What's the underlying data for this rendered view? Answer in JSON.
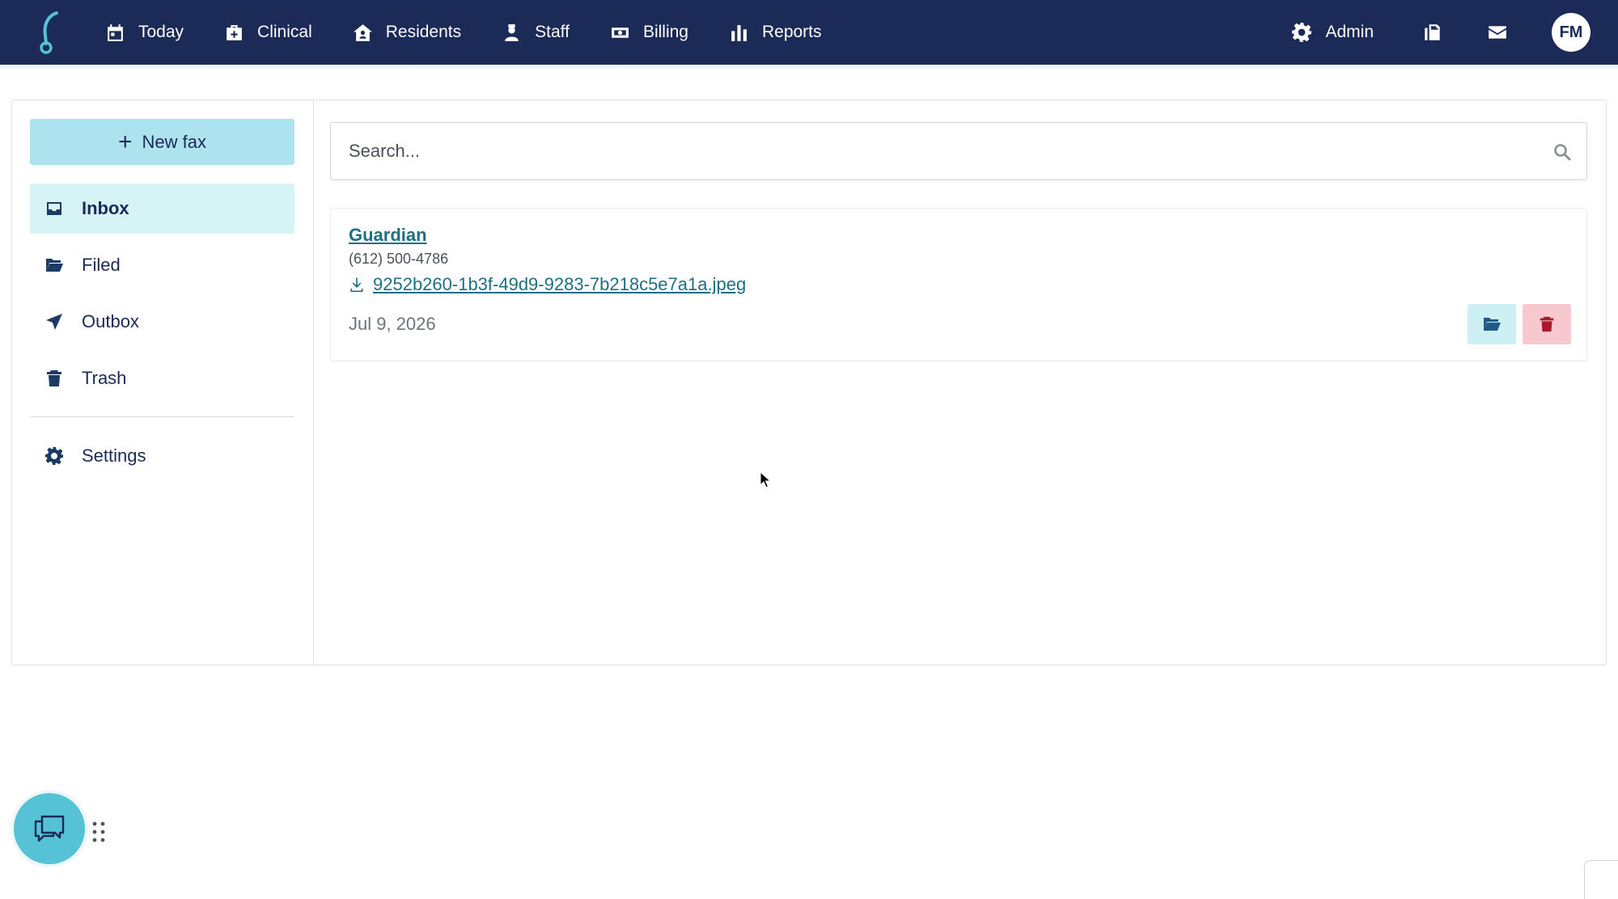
{
  "nav": {
    "items": [
      {
        "label": "Today",
        "icon": "calendar-icon"
      },
      {
        "label": "Clinical",
        "icon": "medical-kit-icon"
      },
      {
        "label": "Residents",
        "icon": "house-user-icon"
      },
      {
        "label": "Staff",
        "icon": "user-nurse-icon"
      },
      {
        "label": "Billing",
        "icon": "money-icon"
      },
      {
        "label": "Reports",
        "icon": "bar-chart-icon"
      }
    ],
    "admin_label": "Admin",
    "avatar_initials": "FM"
  },
  "sidebar": {
    "new_fax_label": "New fax",
    "items": [
      {
        "label": "Inbox",
        "icon": "inbox-icon",
        "active": true
      },
      {
        "label": "Filed",
        "icon": "folder-open-icon"
      },
      {
        "label": "Outbox",
        "icon": "paper-plane-icon"
      },
      {
        "label": "Trash",
        "icon": "trash-icon"
      }
    ],
    "settings_label": "Settings"
  },
  "search": {
    "placeholder": "Search...",
    "value": ""
  },
  "faxes": [
    {
      "sender": "Guardian",
      "phone": "(612) 500-4786",
      "file": "9252b260-1b3f-49d9-9283-7b218c5e7a1a.jpeg",
      "date": "Jul 9, 2026"
    }
  ],
  "colors": {
    "nav_bg": "#1b2a56",
    "accent": "#56c2d6",
    "link": "#1f6f83",
    "danger": "#a51d2d"
  }
}
